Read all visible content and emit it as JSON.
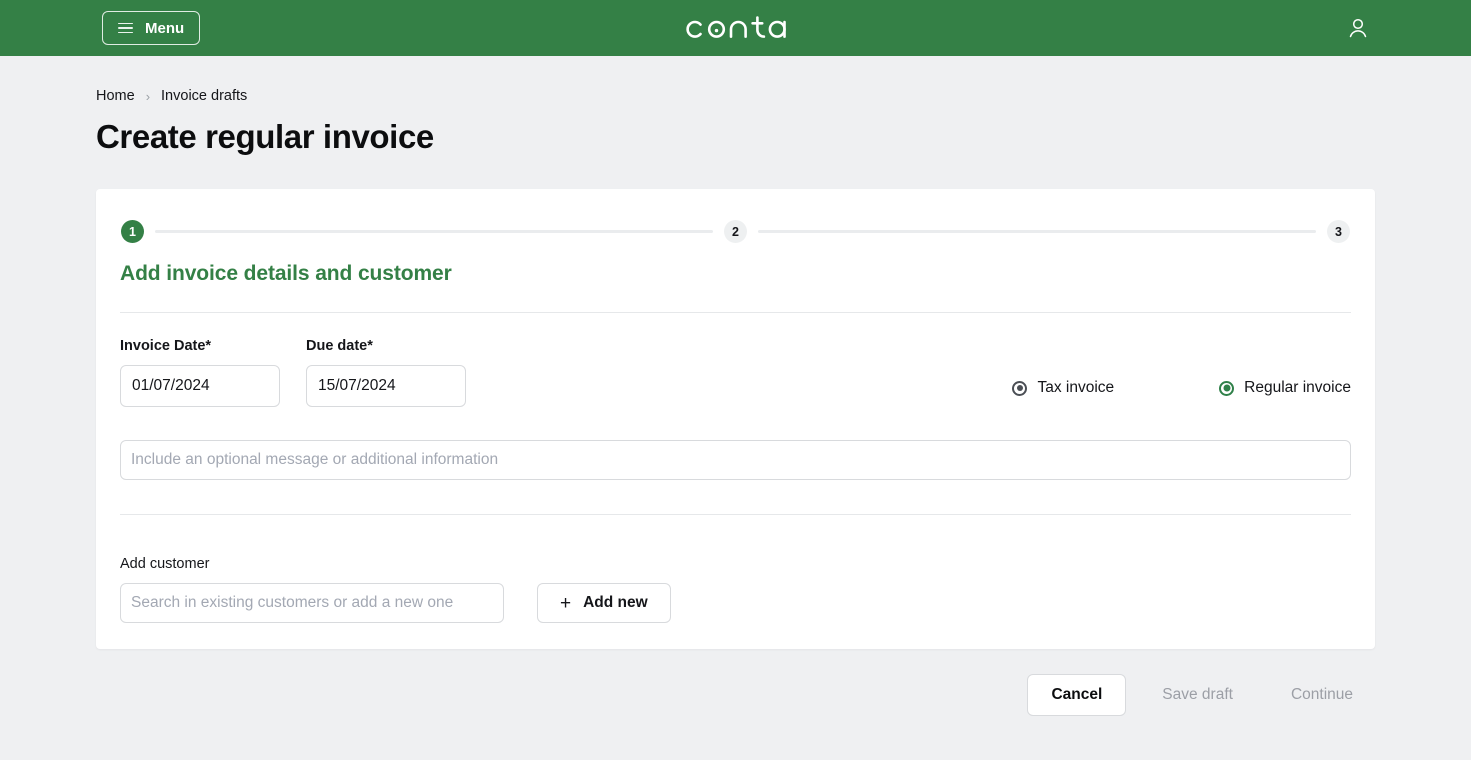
{
  "topbar": {
    "menu_label": "Menu",
    "logo_text": "conta",
    "menu_icon": "hamburger-icon",
    "account_icon": "user-icon",
    "background_color": "#348046"
  },
  "breadcrumb": {
    "items": [
      {
        "label": "Home"
      },
      {
        "label": "Invoice drafts"
      }
    ],
    "separator": "›"
  },
  "page": {
    "title": "Create regular invoice",
    "background_color": "#eff0f2"
  },
  "stepper": {
    "steps": [
      {
        "number": "1",
        "state": "active"
      },
      {
        "number": "2",
        "state": "idle"
      },
      {
        "number": "3",
        "state": "idle"
      }
    ],
    "active_color": "#348046"
  },
  "form": {
    "section_heading": "Add invoice details and customer",
    "invoice_date": {
      "label": "Invoice Date*",
      "value": "01/07/2024",
      "icon": "calendar-icon"
    },
    "due_date": {
      "label": "Due date*",
      "value": "15/07/2024",
      "icon": "calendar-icon"
    },
    "invoice_type": {
      "options": [
        {
          "label": "Tax invoice",
          "selected": false
        },
        {
          "label": "Regular invoice",
          "selected": true
        }
      ],
      "selected_color": "#2f8049"
    },
    "message": {
      "value": "",
      "placeholder": "Include an optional message or additional information"
    },
    "customer": {
      "label": "Add customer",
      "search_value": "",
      "search_placeholder": "Search in existing customers or add a new one",
      "add_new_label": "Add new",
      "add_new_icon": "plus-icon"
    }
  },
  "actions": {
    "cancel_label": "Cancel",
    "save_draft_label": "Save draft",
    "continue_label": "Continue"
  }
}
